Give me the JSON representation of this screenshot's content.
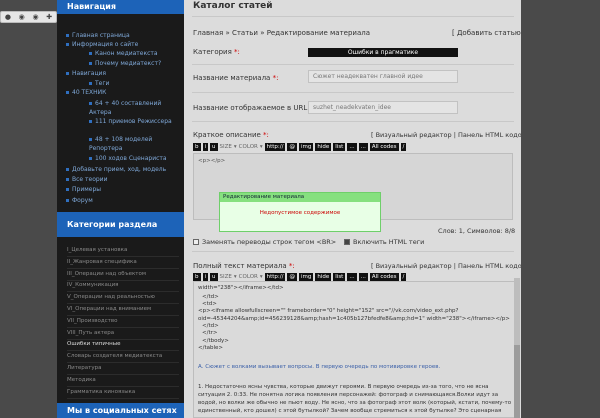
{
  "toolbar": {
    "icons": [
      "dot-icon",
      "eye-icon",
      "eye-icon",
      "puzzle-icon"
    ]
  },
  "sidebar": {
    "nav_title": "Навигация",
    "nav_items": [
      {
        "label": "Главная страница",
        "level": 0
      },
      {
        "label": "Информация о сайте",
        "level": 0
      },
      {
        "label": "Канон медиатекста",
        "level": 1
      },
      {
        "label": "Почему медиатекст?",
        "level": 1
      },
      {
        "label": "Навигация",
        "level": 0
      },
      {
        "label": "Теги",
        "level": 1
      },
      {
        "label": "40 ТЕХНИК",
        "level": 0
      },
      {
        "label": "64 + 40 составлений Актера",
        "level": 1
      },
      {
        "label": "111 приемов Режиссера",
        "level": 1
      },
      {
        "label": "48 + 108 моделей Репортера",
        "level": 1
      },
      {
        "label": "100 ходов Сценариста",
        "level": 1
      },
      {
        "label": "Добавьте прием, ход, модель",
        "level": 0
      },
      {
        "label": "Все теории",
        "level": 0
      },
      {
        "label": "Примеры",
        "level": 0
      },
      {
        "label": "Форум",
        "level": 0
      }
    ],
    "cat_title": "Категории раздела",
    "categories": [
      "I_Целевая установка",
      "II_Жанровая специфика",
      "III_Операции над объектом",
      "IV_Коммуникация",
      "V_Операции над реальностью",
      "VI_Операции над вниманием",
      "VII_Производство",
      "VIII_Путь актера",
      "Ошибки типичные",
      "Словарь создателя медиатекста",
      "Литература",
      "Методика",
      "Грамматика киноязыка"
    ],
    "active_category": 8,
    "social_title": "Мы в социальных сетях"
  },
  "main": {
    "page_title": "Каталог статей",
    "breadcrumb": "Главная » Статьи » Редактирование материала",
    "add_article": "[ Добавить статью ]",
    "category_label": "Категория",
    "category_value": "Ошибки в прагматике",
    "name_label": "Название материала",
    "name_value": "Сюжет неадекватен главной идее",
    "url_label": "Название отображаемое в URL:",
    "url_value": "suzhet_neadekvaten_idee",
    "short_label": "Краткое описание",
    "short_editor": "[ Визуальный редактор | Панель HTML кодов ]",
    "code_tb": [
      "b",
      "i",
      "u",
      "SIZE",
      "COLOR",
      "http://",
      "@",
      "img",
      "hide",
      "list",
      "...",
      "...",
      "All codes",
      "/"
    ],
    "short_content": "<p></p>",
    "stats": "Слов: 1, Символов: 8/8",
    "replace_breaks": "Заменять переводы строк тегом <BR>",
    "enable_html": "Включить HTML теги",
    "full_label": "Полный текст материала",
    "full_editor": "[ Визуальный редактор | Панель HTML кодов ]",
    "code_lines": [
      "width=\"238\"></iframe></td>",
      "</td>",
      "<td>",
      "<p><iframe allowfullscreen=\"\" frameborder=\"0\" height=\"152\" src=\"//vk.com/video_ext.php?",
      "oid=-45344204&amp;id=456239128&amp;hash=1c405b127bfedfe8&amp;hd=1\" width=\"238\"></iframe></p>",
      "</td>",
      "</tr>",
      "</tbody>",
      "</table>"
    ],
    "para1": "А. Сюжет с волками вызывает вопросы. В первую очередь по мотивировке героев.",
    "para2_1": "1. Недостаточно ясны чувства, которые движут героями. В первую очередь из-за того, что не ясна",
    "para2_2": "ситуация 2. 0:33. Не понятна логика появления персонажей: фотограф и снимающаяся.Волки идут за",
    "para2_3": "водой, но волки же обычно не пьют воду. Не ясно, что за фотограф этот волк (который, кстати, почему-то",
    "para2_4": "единственный, кто дошел) с этой бутылкой? Зачем вообще стремиться к этой бутылке? Это сценарная"
  },
  "modal": {
    "title": "Редактирование материала",
    "message": "Недопустимое содержимое"
  }
}
